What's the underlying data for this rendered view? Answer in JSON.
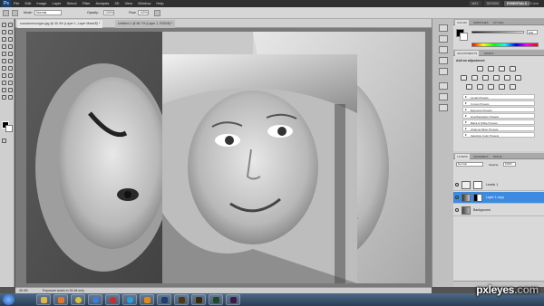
{
  "app": {
    "logo": "Ps",
    "menu": [
      "File",
      "Edit",
      "Image",
      "Layer",
      "Select",
      "Filter",
      "Analysis",
      "3D",
      "View",
      "Window",
      "Help"
    ]
  },
  "workspace": {
    "tabs": [
      "MAY",
      "DESIGN",
      "ESSENTIALS"
    ],
    "active": "ESSENTIALS",
    "cs_live": "CS Live"
  },
  "options": {
    "mode_label": "Mode:",
    "mode_value": "Normal",
    "opacity_label": "Opacity:",
    "opacity_value": "100%",
    "flow_label": "Flow:",
    "flow_value": "100%"
  },
  "document": {
    "tabs": [
      "suzzannemorgan.jpg @ 40.4% (Layer 1, Layer Mask/8) *",
      "Untitled-1 @ 66.7% (Layer 1, RGB/8) *"
    ],
    "zoom": "40.4%",
    "status": "Exposure works in 32-bit only"
  },
  "panels": {
    "color_tabs": [
      "COLOR",
      "SWATCHES",
      "STYLES"
    ],
    "color_k_value": "100",
    "adjustments_tabs": [
      "ADJUSTMENTS",
      "MASKS"
    ],
    "adjustments_title": "Add an adjustment",
    "presets": [
      "Levels Presets",
      "Curves Presets",
      "Exposure Presets",
      "Hue/Saturation Presets",
      "Black & White Presets",
      "Channel Mixer Presets",
      "Selective Color Presets"
    ],
    "layers_tabs": [
      "LAYERS",
      "CHANNELS",
      "PATHS"
    ],
    "blend_mode": "Normal",
    "opacity_label": "Opacity:",
    "opacity_value": "100%",
    "layers": [
      {
        "name": "Levels 1",
        "selected": false
      },
      {
        "name": "Layer 1 copy",
        "selected": true
      },
      {
        "name": "Background",
        "selected": false
      }
    ]
  },
  "watermark": {
    "brand": "pxleyes",
    "suffix": ".com"
  },
  "colors": {
    "accent": "#3d8be0",
    "chrome": "#2f2f2f"
  }
}
